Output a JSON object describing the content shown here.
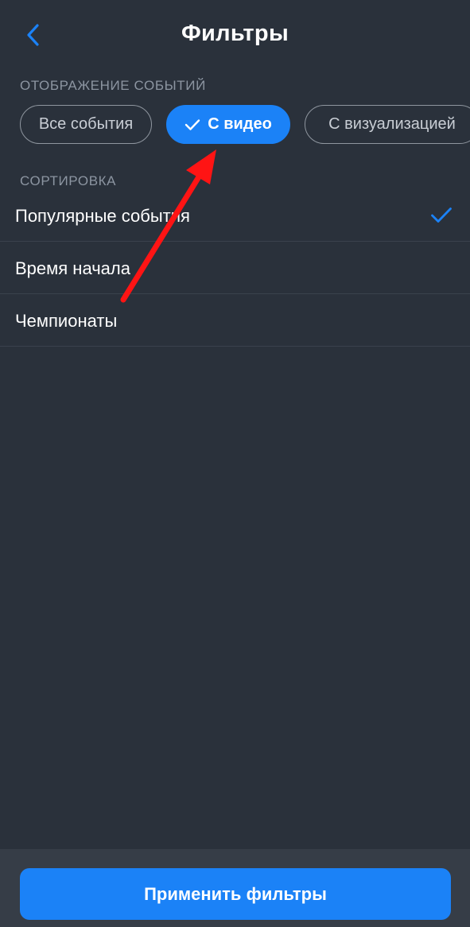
{
  "header": {
    "title": "Фильтры",
    "back_icon": "chevron-left-icon"
  },
  "display_section": {
    "label": "ОТОБРАЖЕНИЕ СОБЫТИЙ",
    "chips": [
      {
        "label": "Все события",
        "selected": false
      },
      {
        "label": "С видео",
        "selected": true,
        "icon": "checkmark-icon"
      },
      {
        "label": "С визуализацией",
        "selected": false
      }
    ]
  },
  "sort_section": {
    "label": "СОРТИРОВКА",
    "items": [
      {
        "label": "Популярные события",
        "selected": true,
        "icon": "checkmark-icon"
      },
      {
        "label": "Время начала",
        "selected": false
      },
      {
        "label": "Чемпионаты",
        "selected": false
      }
    ]
  },
  "footer": {
    "apply_label": "Применить фильтры"
  },
  "colors": {
    "background": "#2a313b",
    "accent": "#1b82f7",
    "annotation_arrow": "#ff1414",
    "muted_text": "#8c95a1"
  }
}
